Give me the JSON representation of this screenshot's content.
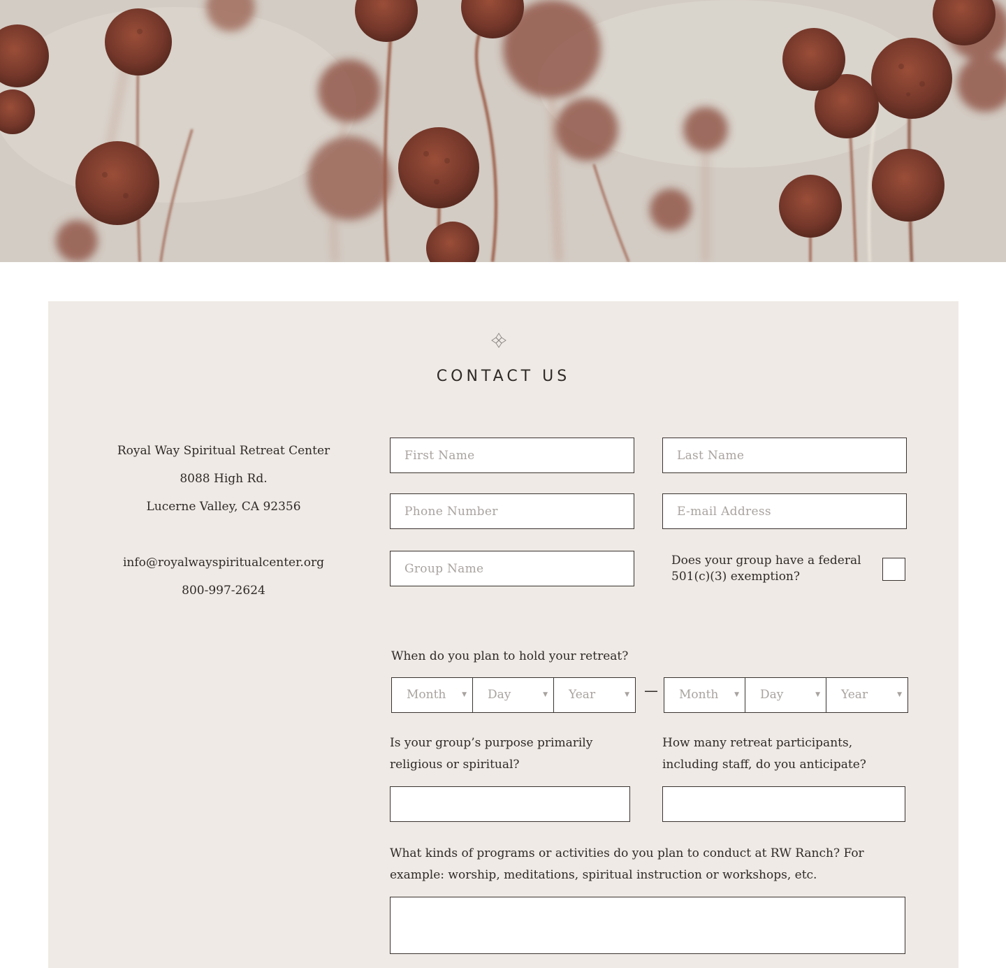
{
  "hero": {
    "image_description_icon": "dried-flowers-photo"
  },
  "contact": {
    "title": "CONTACT US",
    "org_name": "Royal Way Spiritual Retreat Center",
    "street": "8088 High Rd.",
    "city_line": "Lucerne Valley, CA 92356",
    "email": "info@royalwayspiritualcenter.org",
    "phone": "800-997-2624"
  },
  "form": {
    "first_name": {
      "placeholder": "First Name",
      "value": ""
    },
    "last_name": {
      "placeholder": "Last Name",
      "value": ""
    },
    "phone_number": {
      "placeholder": "Phone Number",
      "value": ""
    },
    "email_address": {
      "placeholder": "E-mail Address",
      "value": ""
    },
    "group_name": {
      "placeholder": "Group Name",
      "value": ""
    },
    "exemption_question": "Does your group have a federal 501(c)(3) exemption?",
    "exemption_checked": false,
    "retreat_date_question": "When do you plan to hold your retreat?",
    "start_date": {
      "month": "Month",
      "day": "Day",
      "year": "Year"
    },
    "date_separator": "—",
    "end_date": {
      "month": "Month",
      "day": "Day",
      "year": "Year"
    },
    "purpose_question": "Is your group’s purpose primarily religious or spiritual?",
    "participants_question": "How many retreat participants, including staff, do you anticipate?",
    "programs_question": "What kinds of programs or activities do you plan to conduct at RW Ranch? For example: worship, meditations, spiritual instruction or workshops, etc."
  },
  "colors": {
    "panel_background": "#efeae5",
    "border": "#3a3330",
    "text": "#2f2a27",
    "placeholder": "#a8a39f",
    "flower": "#7a3c2c"
  }
}
